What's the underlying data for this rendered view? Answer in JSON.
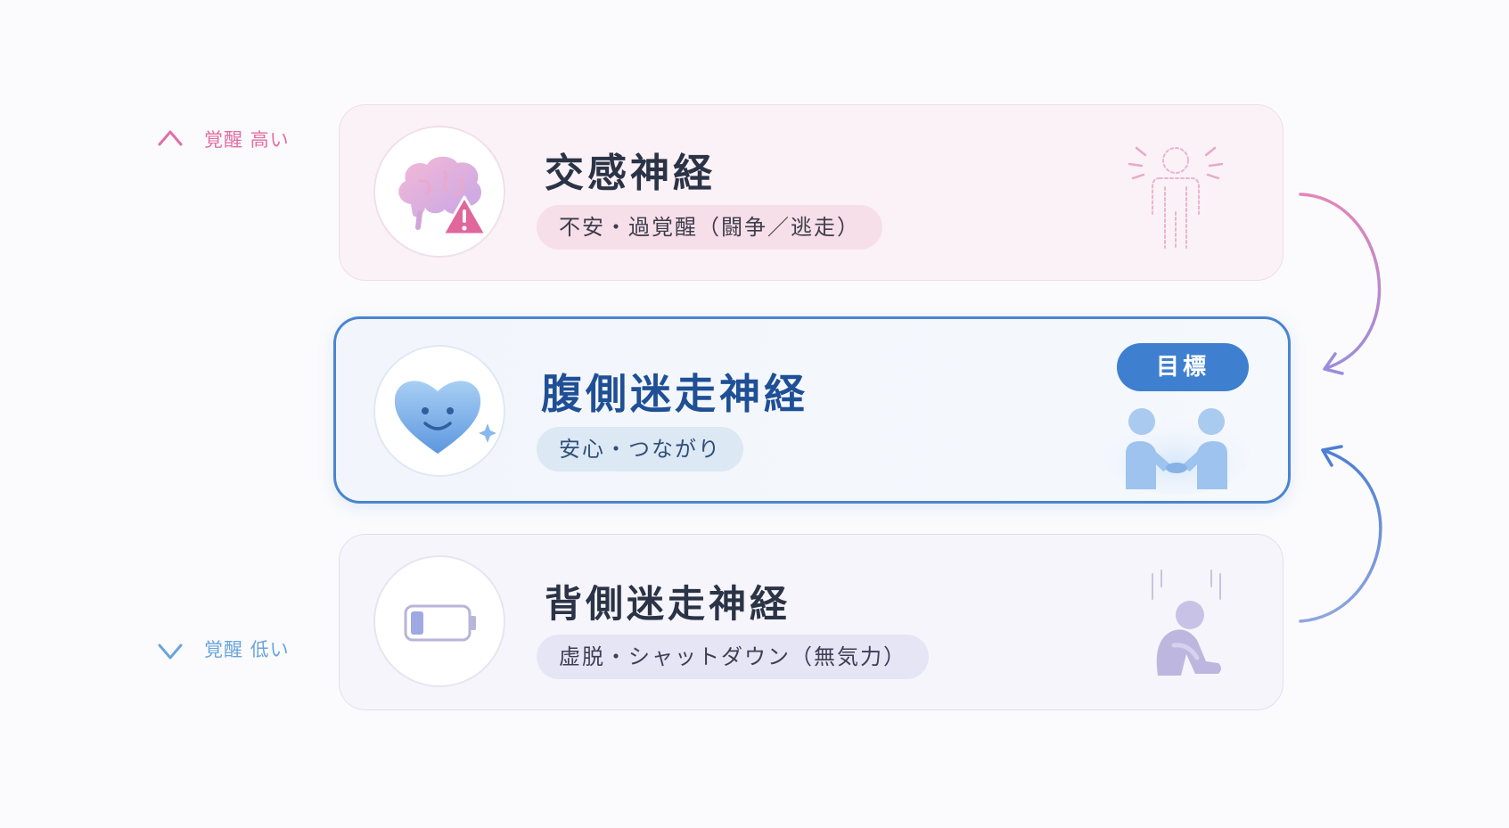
{
  "axis": {
    "high_label": "覚醒 高い",
    "low_label": "覚醒 低い",
    "high_color": "#e26ea4",
    "low_color": "#6aa4dc"
  },
  "states": [
    {
      "title": "交感神経",
      "description": "不安・過覚醒（闘争／逃走）",
      "icon": "brain-warning-icon",
      "figure": "agitated-person-icon",
      "accent": "#e88fb8"
    },
    {
      "title": "腹側迷走神経",
      "description": "安心・つながり",
      "icon": "smiling-heart-icon",
      "figure": "handshake-icon",
      "badge": "目標",
      "accent": "#3f7fd0"
    },
    {
      "title": "背側迷走神経",
      "description": "虚脱・シャットダウン（無気力）",
      "icon": "low-battery-icon",
      "figure": "collapsed-person-icon",
      "accent": "#9d9ad8"
    }
  ]
}
